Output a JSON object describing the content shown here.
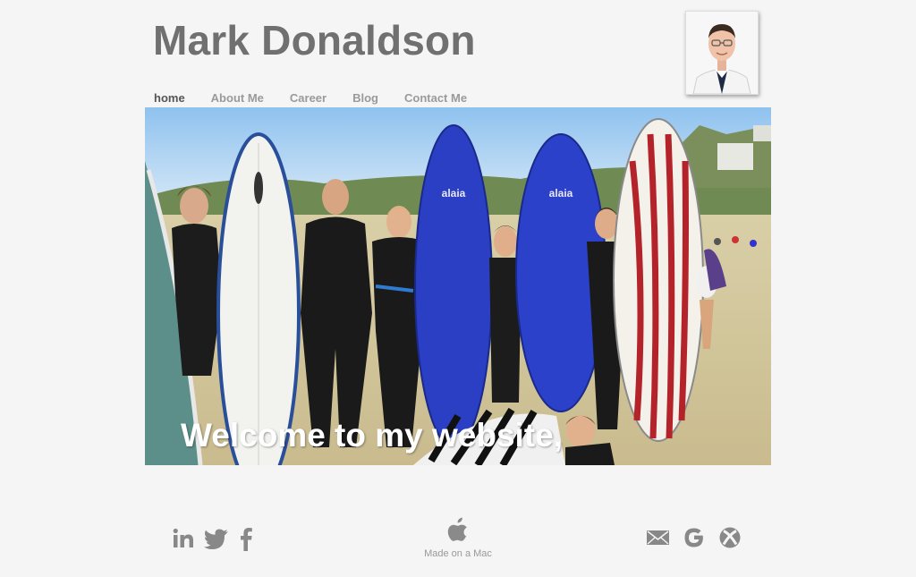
{
  "header": {
    "title": "Mark Donaldson"
  },
  "nav": {
    "items": [
      {
        "label": "home",
        "active": true
      },
      {
        "label": "About Me",
        "active": false
      },
      {
        "label": "Career",
        "active": false
      },
      {
        "label": "Blog",
        "active": false
      },
      {
        "label": "Contact Me",
        "active": false
      }
    ]
  },
  "hero": {
    "caption": "Welcome to my website,"
  },
  "footer": {
    "social_icons": [
      "linkedin-icon",
      "twitter-icon",
      "facebook-icon"
    ],
    "center_label": "Made on a Mac",
    "center_icon": "apple-icon",
    "contact_icons": [
      "mail-icon",
      "google-icon",
      "xbox-icon"
    ]
  },
  "colors": {
    "background": "#f5f5f5",
    "title": "#707070",
    "nav_active": "#555555",
    "nav_inactive": "#9a9a9a",
    "icon": "#888888"
  }
}
